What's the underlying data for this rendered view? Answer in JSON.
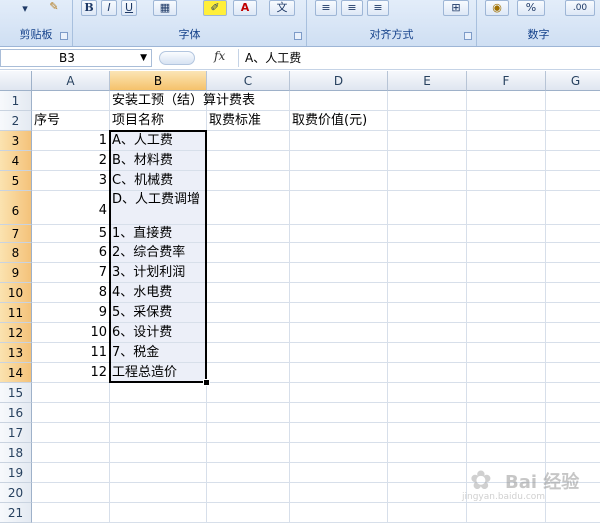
{
  "ribbon": {
    "groups": [
      {
        "label": "剪贴板"
      },
      {
        "label": "字体"
      },
      {
        "label": "对齐方式"
      },
      {
        "label": "数字"
      }
    ],
    "font_buttons": {
      "bold": "B",
      "italic": "I",
      "underline": "U",
      "font_color": "A"
    },
    "wen_button": "文",
    "percent_button": "%",
    "decimal_button": ".00"
  },
  "formula_bar": {
    "name_box": "B3",
    "fx": "fx",
    "content": "A、人工费"
  },
  "columns": [
    "A",
    "B",
    "C",
    "D",
    "E",
    "F",
    "G"
  ],
  "selected_column": "B",
  "rows": [
    {
      "n": "1",
      "A": "",
      "B": "安装工预（结）算计费表",
      "C": "",
      "D": ""
    },
    {
      "n": "2",
      "A": "序号",
      "B": "项目名称",
      "C": "取费标准",
      "D": "取费价值(元)"
    },
    {
      "n": "3",
      "A": "1",
      "B": "A、人工费"
    },
    {
      "n": "4",
      "A": "2",
      "B": "B、材料费"
    },
    {
      "n": "5",
      "A": "3",
      "B": "C、机械费"
    },
    {
      "n": "6",
      "A": "4",
      "B": "D、人工费调增"
    },
    {
      "n": "7",
      "A": "5",
      "B": "1、直接费"
    },
    {
      "n": "8",
      "A": "6",
      "B": "2、综合费率"
    },
    {
      "n": "9",
      "A": "7",
      "B": "3、计划利润"
    },
    {
      "n": "10",
      "A": "8",
      "B": "4、水电费"
    },
    {
      "n": "11",
      "A": "9",
      "B": "5、采保费"
    },
    {
      "n": "12",
      "A": "10",
      "B": "6、设计费"
    },
    {
      "n": "13",
      "A": "11",
      "B": "7、税金"
    },
    {
      "n": "14",
      "A": "12",
      "B": "工程总造价"
    },
    {
      "n": "15"
    },
    {
      "n": "16"
    },
    {
      "n": "17"
    },
    {
      "n": "18"
    },
    {
      "n": "19"
    },
    {
      "n": "20"
    },
    {
      "n": "21"
    }
  ],
  "watermark": {
    "brand": "Bai 经验",
    "url": "jingyan.baidu.com"
  }
}
